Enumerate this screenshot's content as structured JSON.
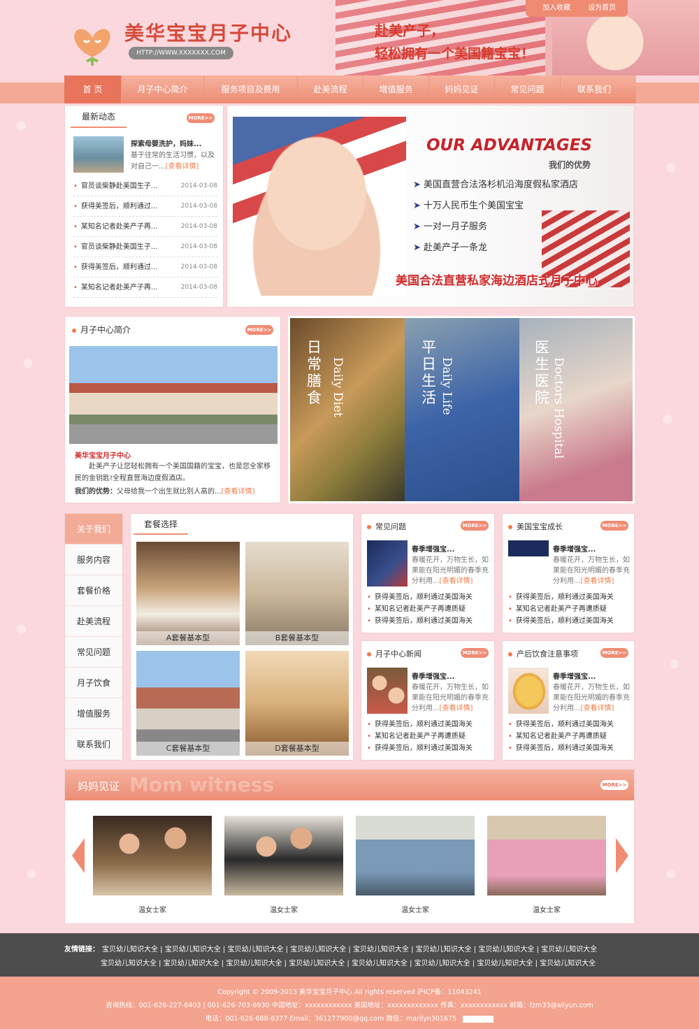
{
  "site": {
    "name": "美华宝宝月子中心",
    "url": "HTTP://WWW.XXXXXXX.COM",
    "slogan1": "赴美产子，",
    "slogan2": "轻松拥有一个美国籍宝宝！"
  },
  "top_links": {
    "favorite": "加入收藏",
    "homepage": "设为首页"
  },
  "nav": [
    "首 页",
    "月子中心简介",
    "服务项目及费用",
    "赴美流程",
    "增值服务",
    "妈妈见证",
    "常见问题",
    "联系我们"
  ],
  "more_label": "MORE>>",
  "latest": {
    "title": "最新动态",
    "feature_title": "探索母婴洗护，妈妹...",
    "feature_text": "基于往常的生活习惯，以及对自己一...",
    "detail": "[查看详情]",
    "items": [
      {
        "t": "官员谈柴静赴美国生子...",
        "d": "2014-03-08"
      },
      {
        "t": "获得美签后，顺利通过...",
        "d": "2014-03-08"
      },
      {
        "t": "某知名记者赴美产子再...",
        "d": "2014-03-08"
      },
      {
        "t": "官员谈柴静赴美国生子...",
        "d": "2014-03-08"
      },
      {
        "t": "获得美签后，顺利通过...",
        "d": "2014-03-08"
      },
      {
        "t": "某知名记者赴美产子再...",
        "d": "2014-03-08"
      }
    ]
  },
  "banner": {
    "heading": "OUR ADVANTAGES",
    "sub": "我们的优势",
    "points": [
      "美国直营合法洛杉机沿海度假私家酒店",
      "十万人民币生个美国宝宝",
      "一对一月子服务",
      "赴美产子一条龙"
    ],
    "footer": "美国合法直营私家海边酒店式月子中心"
  },
  "intro": {
    "title": "月子中心简介",
    "name": "美华宝宝月子中心",
    "text": "赴美产子让您轻松拥有一个美国国籍的宝宝，也是您全家移民的金钥匙!全程直营海边度假酒店。",
    "adv_label": "我们的优势：",
    "adv_text": "父母给我一个出生就比别人高的...",
    "detail": "[查看详情]"
  },
  "features": [
    {
      "cn": "日常膳食",
      "en": "Daily Diet"
    },
    {
      "cn": "平日生活",
      "en": "Daily Life"
    },
    {
      "cn": "医生医院",
      "en": "Doctors Hospital"
    }
  ],
  "side_menu": [
    "关于我们",
    "服务内容",
    "套餐价格",
    "赴美流程",
    "常见问题",
    "月子饮食",
    "增值服务",
    "联系我们"
  ],
  "packages": {
    "title": "套餐选择",
    "items": [
      "A套餐基本型",
      "B套餐基本型",
      "C套餐基本型",
      "D套餐基本型"
    ]
  },
  "mini_panels": [
    {
      "title": "常见问题",
      "head": "春季增强宝...",
      "text": "春暖花开，万物生长，如果能在阳光明媚的春季充分利用...",
      "detail": "[查看详情]",
      "list": [
        "获得美签后，顺利通过美国海关",
        "某知名记者赴美产子再遭质疑",
        "获得美签后，顺利通过美国海关"
      ]
    },
    {
      "title": "美国宝宝成长",
      "head": "春季增强宝...",
      "text": "春暖花开，万物生长，如果能在阳光明媚的春季充分利用...",
      "detail": "[查看详情]",
      "list": [
        "获得美签后，顺利通过美国海关",
        "某知名记者赴美产子再遭质疑",
        "获得美签后，顺利通过美国海关"
      ]
    },
    {
      "title": "月子中心新闻",
      "head": "春季增强宝...",
      "text": "春暖花开，万物生长，如果能在阳光明媚的春季充分利用...",
      "detail": "[查看详情]",
      "list": [
        "获得美签后，顺利通过美国海关",
        "某知名记者赴美产子再遭质疑",
        "获得美签后，顺利通过美国海关"
      ]
    },
    {
      "title": "产后饮食注意事项",
      "head": "春季增强宝...",
      "text": "春暖花开，万物生长，如果能在阳光明媚的春季充分利用...",
      "detail": "[查看详情]",
      "list": [
        "获得美签后，顺利通过美国海关",
        "某知名记者赴美产子再遭质疑",
        "获得美签后，顺利通过美国海关"
      ]
    }
  ],
  "witness": {
    "title": "妈妈见证",
    "en": "Mom witness",
    "photos": [
      "温女士家",
      "温女士家",
      "温女士家",
      "温女士家"
    ]
  },
  "friend_links": {
    "label": "友情链接：",
    "row1": [
      "宝贝幼儿知识大全",
      "宝贝幼儿知识大全",
      "宝贝幼儿知识大全",
      "宝贝幼儿知识大全",
      "宝贝幼儿知识大全",
      "宝贝幼儿知识大全",
      "宝贝幼儿知识大全",
      "宝贝幼儿知识大全"
    ],
    "row2": [
      "宝贝幼儿知识大全",
      "宝贝幼儿知识大全",
      "宝贝幼儿知识大全",
      "宝贝幼儿知识大全",
      "宝贝幼儿知识大全",
      "宝贝幼儿知识大全",
      "宝贝幼儿知识大全",
      "宝贝幼儿知识大全"
    ]
  },
  "footer": {
    "line1": "Copyright © 2009-2013 美华宝宝月子中心 All rights reserved 沪ICP备：11043241",
    "line2": "咨询热线：001-626-227-6403 | 001-626-703-6930   中国地址：xxxxxxxxxxxx   美国地址：xxxxxxxxxxxxx   传真：xxxxxxxxxxxx   邮箱：fzm33@aliyun.com",
    "line3": "电话：001-626-688-8377   Email：361277900@qq.com   微信：marilyn301675"
  }
}
